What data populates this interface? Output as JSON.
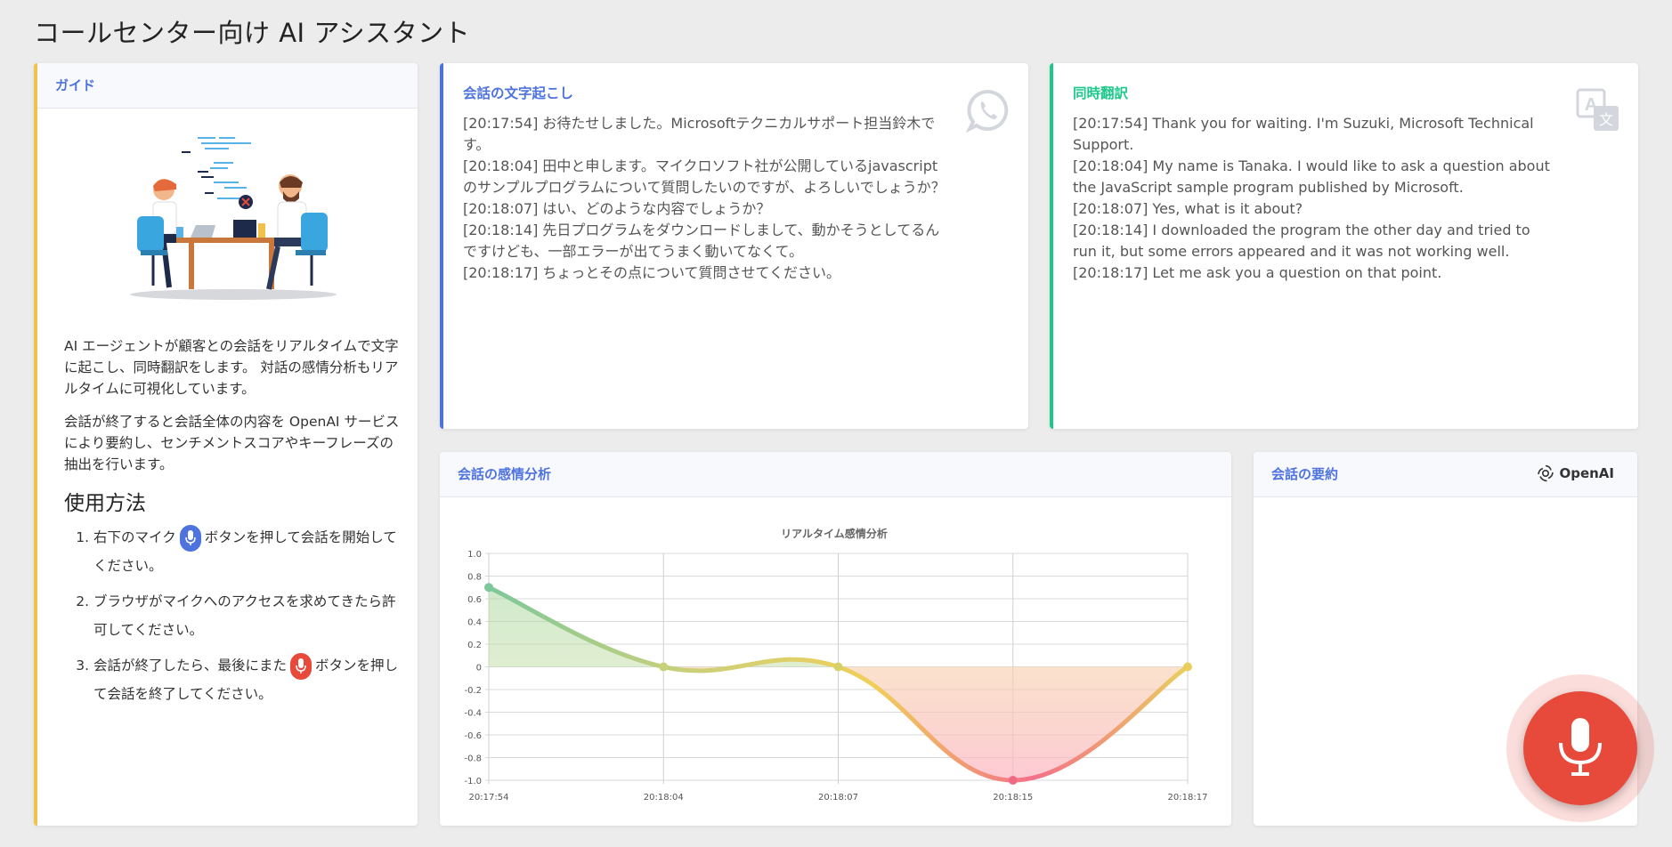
{
  "app": {
    "title": "コールセンター向け AI アシスタント"
  },
  "guide": {
    "header": "ガイド",
    "intro": "AI エージェントが顧客との会話をリアルタイムで文字に起こし、同時翻訳をします。 対話の感情分析もリアルタイムに可視化しています。",
    "summary_note": "会話が終了すると会話全体の内容を OpenAI サービスにより要約し、センチメントスコアやキーフレーズの抽出を行います。",
    "usage_title": "使用方法",
    "steps": [
      {
        "before": "右下のマイク",
        "after": "ボタンを押して会話を開始してください。"
      },
      {
        "text": "ブラウザがマイクへのアクセスを求めてきたら許可してください。"
      },
      {
        "before": "会話が終了したら、最後にまた",
        "after": "ボタンを押して会話を終了してください。"
      }
    ]
  },
  "transcript": {
    "title": "会話の文字起こし",
    "icon": "whatsapp-icon",
    "lines": [
      "[20:17:54] お待たせしました。Microsoftテクニカルサポート担当鈴木です。",
      "[20:18:04] 田中と申します。マイクロソフト社が公開しているjavascriptのサンプルプログラムについて質問したいのですが、よろしいでしょうか？",
      "[20:18:07] はい、どのような内容でしょうか？",
      "[20:18:14] 先日プログラムをダウンロードしまして、動かそうとしてるんですけども、一部エラーが出てうまく動いてなくて。",
      "[20:18:17] ちょっとその点について質問させてください。"
    ]
  },
  "translation": {
    "title": "同時翻訳",
    "icon": "translate-icon",
    "lines": [
      "[20:17:54] Thank you for waiting. I'm Suzuki, Microsoft Technical Support.",
      "[20:18:04] My name is Tanaka. I would like to ask a question about the JavaScript sample program published by Microsoft.",
      "[20:18:07] Yes, what is it about?",
      "[20:18:14] I downloaded the program the other day and tried to run it, but some errors appeared and it was not working well.",
      "[20:18:17] Let me ask you a question on that point."
    ]
  },
  "sentiment": {
    "header": "会話の感情分析"
  },
  "summary": {
    "header": "会話の要約",
    "openai_label": "OpenAI"
  },
  "colors": {
    "primary": "#4e73df",
    "success": "#1cc88a",
    "warning": "#f0c14b",
    "danger": "#e74a3b"
  },
  "chart_data": {
    "type": "line",
    "title": "リアルタイム感情分析",
    "categories": [
      "20:17:54",
      "20:18:04",
      "20:18:07",
      "20:18:15",
      "20:18:17"
    ],
    "series": [
      {
        "values": [
          0.7,
          0.0,
          0.0,
          -1.0,
          0.0
        ]
      }
    ],
    "ylim": [
      -1.0,
      1.0
    ],
    "yticks": [
      "1.0",
      "0.8",
      "0.6",
      "0.4",
      "0.2",
      "0",
      "-0.2",
      "-0.4",
      "-0.6",
      "-0.8",
      "-1.0"
    ],
    "fill": true,
    "grid": true
  }
}
